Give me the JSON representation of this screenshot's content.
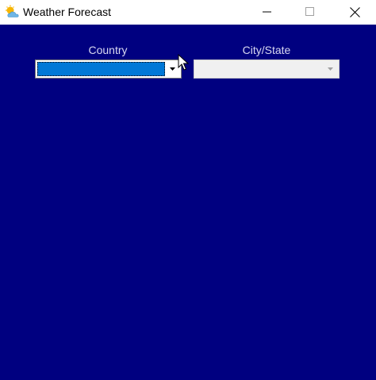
{
  "window": {
    "title": "Weather Forecast",
    "icon": "weather-sun-cloud-icon"
  },
  "controls": {
    "minimize": "minimize-icon",
    "maximize": "maximize-icon",
    "close": "close-icon"
  },
  "form": {
    "country_label": "Country",
    "city_label": "City/State",
    "country_value": "",
    "city_value": ""
  },
  "colors": {
    "client_background": "#000080",
    "selection": "#0078d7",
    "label_text": "#d8d8f0"
  }
}
